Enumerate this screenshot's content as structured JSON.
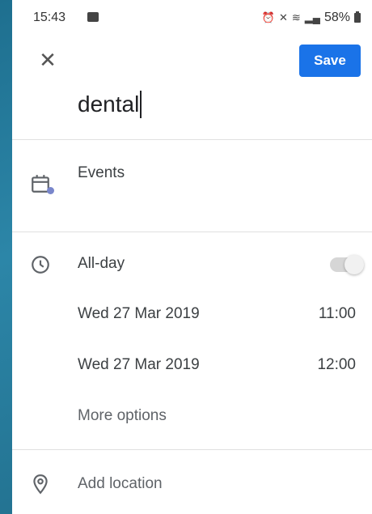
{
  "status_bar": {
    "time": "15:43",
    "battery_percent": "58%"
  },
  "header": {
    "close_icon": "close-icon",
    "save_label": "Save"
  },
  "event": {
    "title": "dental",
    "calendar_label": "Events",
    "all_day_label": "All-day",
    "all_day_enabled": false,
    "start_date": "Wed 27 Mar 2019",
    "start_time": "11:00",
    "end_date": "Wed 27 Mar 2019",
    "end_time": "12:00",
    "more_options": "More options",
    "add_location": "Add location"
  },
  "colors": {
    "accent": "#1a73e8",
    "calendar_dot": "#7986cb"
  }
}
